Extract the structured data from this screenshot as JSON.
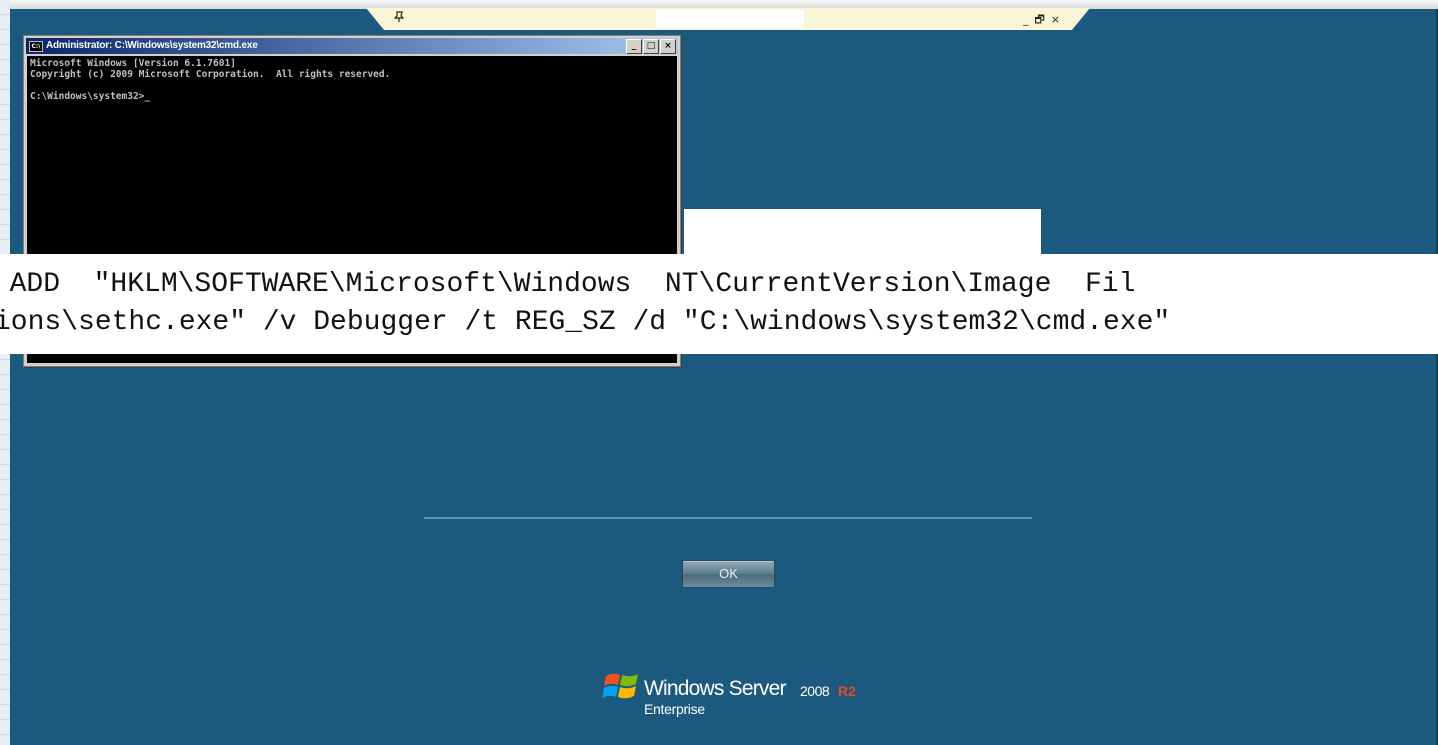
{
  "rdp_bar": {
    "pin_icon": "pin-icon",
    "controls": [
      "_",
      "🗗",
      "×"
    ]
  },
  "cmd_window": {
    "icon_label": "C:\\",
    "title": "Administrator: C:\\Windows\\system32\\cmd.exe",
    "buttons": [
      "_",
      "□",
      "×"
    ],
    "console_lines": [
      "Microsoft Windows [Version 6.1.7601]",
      "Copyright (c) 2009 Microsoft Corporation.  All rights reserved.",
      "",
      "C:\\Windows\\system32>_"
    ]
  },
  "overlay": {
    "line1": "E ADD  \"HKLM\\SOFTWARE\\Microsoft\\Windows  NT\\CurrentVersion\\Image  Fil",
    "line2": "ions\\sethc.exe\" /v Debugger /t REG_SZ /d \"C:\\windows\\system32\\cmd.exe\""
  },
  "login": {
    "ok_label": "OK"
  },
  "branding": {
    "product": "Windows Server",
    "version": "2008",
    "release": "R2",
    "edition": "Enterprise"
  },
  "colors": {
    "desktop": "#1b5a7e",
    "rdp_bar": "#f9f7d6",
    "console_bg": "#000000",
    "console_text": "#c0c0c0",
    "titlebar": "#0a246a",
    "release_red": "#e14a2a"
  }
}
